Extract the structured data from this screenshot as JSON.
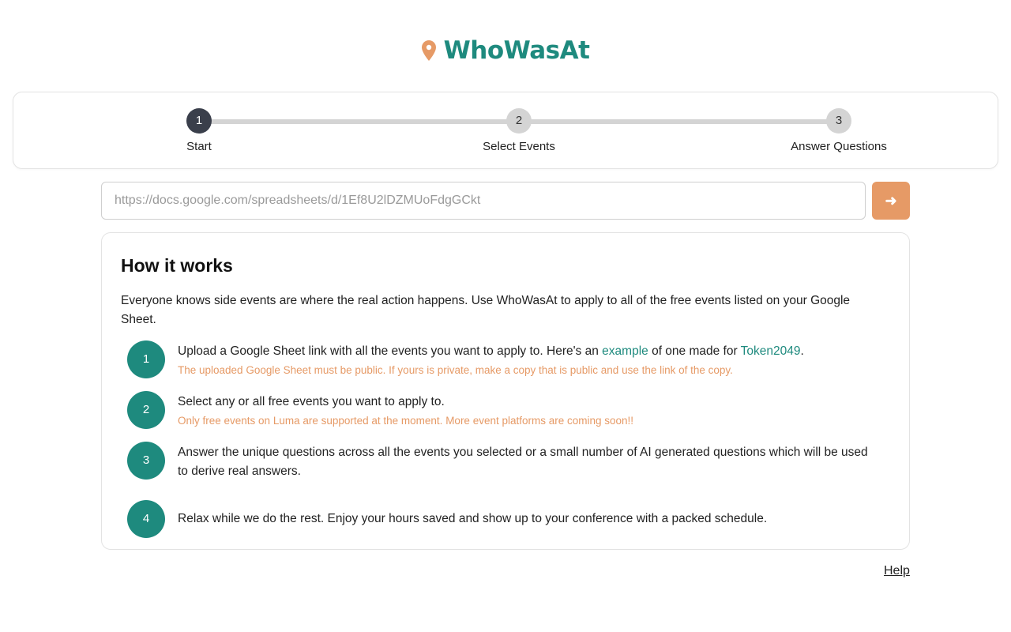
{
  "brand": {
    "name": "WhoWasAt",
    "icon": "map-pin-icon",
    "pin_color": "#e69a66",
    "name_color": "#1e8a7e"
  },
  "stepper": {
    "steps": [
      {
        "number": "1",
        "label": "Start",
        "active": true
      },
      {
        "number": "2",
        "label": "Select Events",
        "active": false
      },
      {
        "number": "3",
        "label": "Answer Questions",
        "active": false
      }
    ]
  },
  "url_input": {
    "value": "",
    "placeholder": "https://docs.google.com/spreadsheets/d/1Ef8U2lDZMUoFdgGCkt"
  },
  "submit_button": {
    "icon": "arrow-right-icon",
    "glyph": "➜",
    "color": "#e69a66"
  },
  "how_it_works": {
    "title": "How it works",
    "intro": "Everyone knows side events are where the real action happens. Use WhoWasAt to apply to all of the free events listed on your Google Sheet.",
    "steps": [
      {
        "number": "1",
        "text_before": "Upload a Google Sheet link with all the events you want to apply to. Here's an ",
        "link1": "example",
        "text_middle": " of one made for ",
        "link2": "Token2049",
        "text_after": ".",
        "note": "The uploaded Google Sheet must be public. If yours is private, make a copy that is public and use the link of the copy."
      },
      {
        "number": "2",
        "text": "Select any or all free events you want to apply to.",
        "note": "Only free events on Luma are supported at the moment. More event platforms are coming soon!!"
      },
      {
        "number": "3",
        "text": "Answer the unique questions across all the events you selected or a small number of AI generated questions which will be used to derive real answers."
      },
      {
        "number": "4",
        "text": "Relax while we do the rest. Enjoy your hours saved and show up to your conference with a packed schedule."
      }
    ]
  },
  "footer": {
    "help_label": "Help"
  },
  "colors": {
    "teal": "#1e8a7e",
    "orange": "#e69a66",
    "active_step": "#3a3f4b",
    "inactive_step": "#d4d4d4"
  }
}
